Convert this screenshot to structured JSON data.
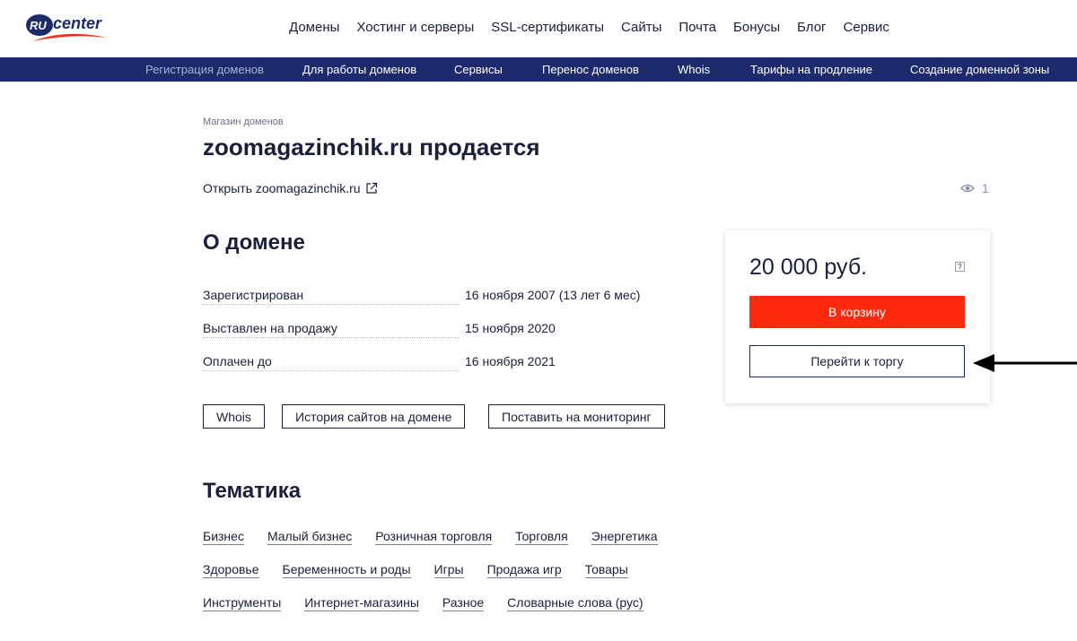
{
  "header": {
    "logo_text_ru": "RU",
    "logo_text_center": "center",
    "nav": [
      "Домены",
      "Хостинг и серверы",
      "SSL-сертификаты",
      "Сайты",
      "Почта",
      "Бонусы",
      "Блог",
      "Сервис"
    ]
  },
  "subnav": [
    "Регистрация доменов",
    "Для работы доменов",
    "Сервисы",
    "Перенос доменов",
    "Whois",
    "Тарифы на продление",
    "Создание доменной зоны"
  ],
  "breadcrumb": "Магазин доменов",
  "title": "zoomagazinchik.ru продается",
  "open_link": "Открыть zoomagazinchik.ru",
  "views_count": "1",
  "about": {
    "heading": "О домене",
    "rows": [
      {
        "label": "Зарегистрирован",
        "value": "16 ноября 2007 (13 лет 6 мес)"
      },
      {
        "label": "Выставлен на продажу",
        "value": "15 ноября 2020"
      },
      {
        "label": "Оплачен до",
        "value": "16 ноября 2021"
      }
    ],
    "buttons": [
      "Whois",
      "История сайтов на домене",
      "Поставить на мониторинг"
    ]
  },
  "topics": {
    "heading": "Тематика",
    "rows": [
      [
        "Бизнес",
        "Малый бизнес",
        "Розничная торговля",
        "Торговля",
        "Энергетика"
      ],
      [
        "Здоровье",
        "Беременность и роды",
        "Игры",
        "Продажа игр",
        "Товары"
      ],
      [
        "Инструменты",
        "Интернет-магазины",
        "Разное",
        "Словарные слова (рус)"
      ]
    ]
  },
  "price_card": {
    "price": "20 000 руб.",
    "help": "?",
    "cart_label": "В корзину",
    "auction_label": "Перейти к торгу"
  },
  "colors": {
    "navy": "#1d2a6b",
    "red": "#ff2a0d",
    "text": "#1a1f3c"
  }
}
